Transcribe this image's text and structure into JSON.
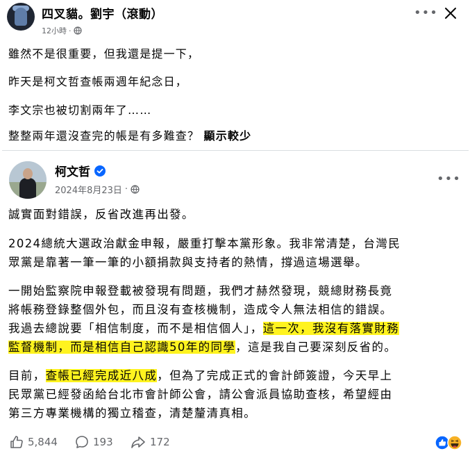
{
  "post": {
    "author": "四叉貓。劉宇（滾動）",
    "time": "12小時",
    "dot": "·",
    "lines": [
      "雖然不是很重要，但我還是提一下，",
      "昨天是柯文哲查帳兩週年紀念日，",
      "李文宗也被切割兩年了……",
      "整整兩年還沒查完的帳是有多難查？"
    ],
    "see_more": "顯示較少"
  },
  "shared": {
    "author": "柯文哲",
    "date": "2024年8月23日",
    "dot": "·",
    "p1": "誠實面對錯誤，反省改進再出發。",
    "p2_l1": "2024總統大選政治獻金申報，嚴重打擊本黨形象。我非常清楚，台灣民",
    "p2_l2": "眾黨是靠著一筆一筆的小額捐款與支持者的熱情，撐過這場選舉。",
    "p3_l1": "一開始監察院申報登載被發現有問題，我們才赫然發現，競總財務長竟",
    "p3_l2": "將帳務登錄整個外包，而且沒有查核機制，造成令人無法相信的錯誤。",
    "p3_l3a": "我過去總說要「相信制度，而不是相信個人」，",
    "p3_l3b": "這一次，我沒有落實財務",
    "p3_l4a": "監督機制，而是相信自己認識50年的同學",
    "p3_l4b": "，這是我自己要深刻反省的。",
    "p4_l1a": "目前，",
    "p4_l1b": "查帳已經完成近八成",
    "p4_l1c": "，但為了完成正式的會計師簽證，今天早上",
    "p4_l2": "民眾黨已經發函給台北市會計師公會，請公會派員協助查核，希望經由",
    "p4_l3": "第三方專業機構的獨立稽查，清楚釐清真相。"
  },
  "stats": {
    "likes": "5,844",
    "comments": "193",
    "shares": "172"
  },
  "colors": {
    "highlight": "#fff31f",
    "verified": "#0866ff",
    "muted": "#65676b"
  }
}
